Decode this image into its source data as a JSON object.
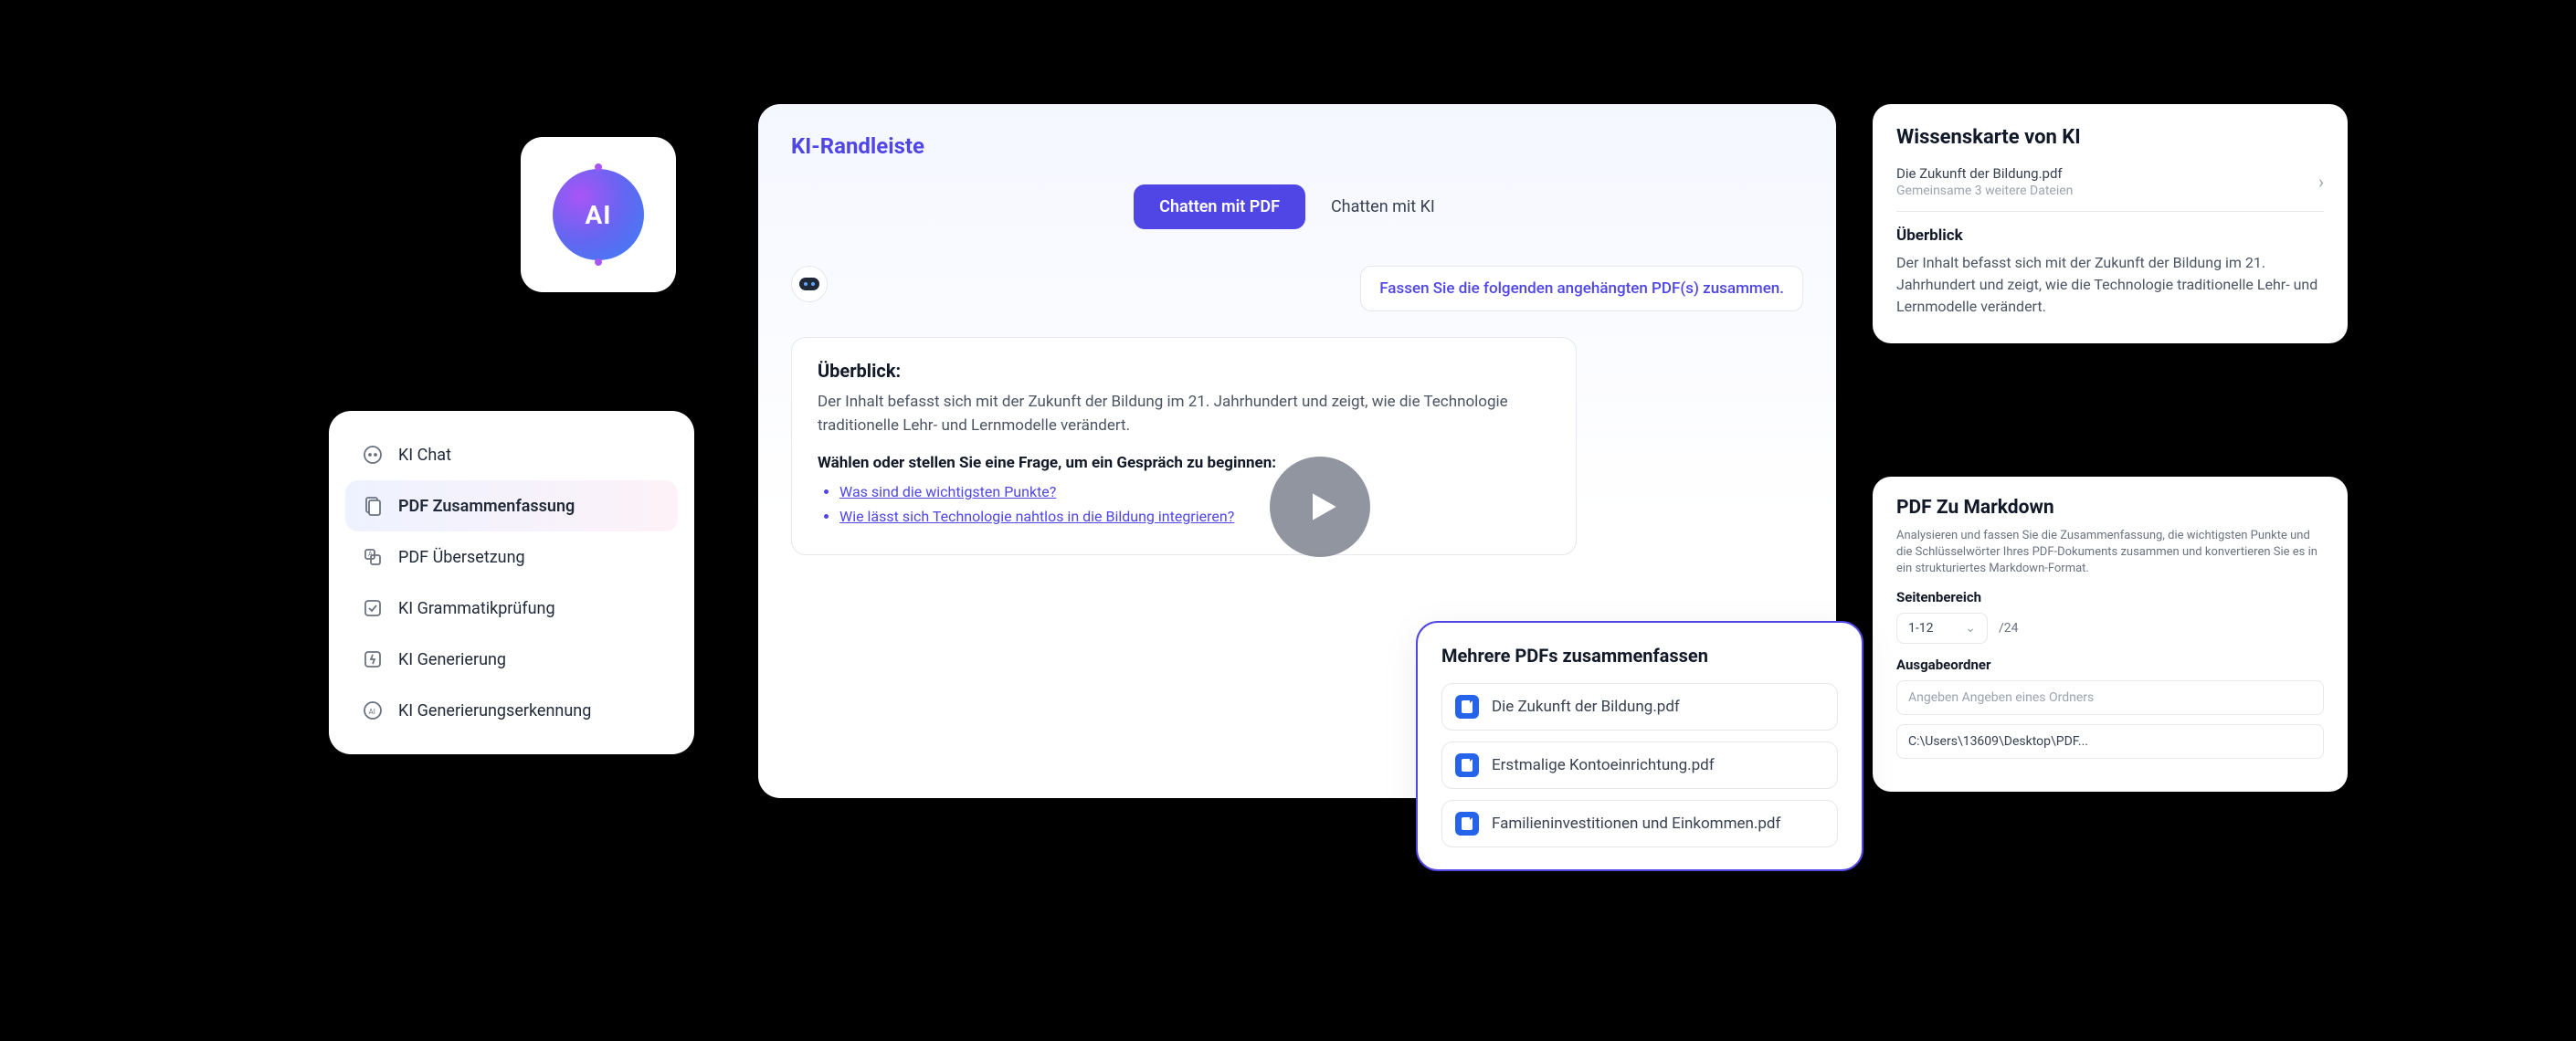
{
  "logo": {
    "text": "AI"
  },
  "sidebar": {
    "items": [
      {
        "label": "KI Chat",
        "icon": "chat-icon"
      },
      {
        "label": "PDF Zusammenfassung",
        "icon": "summary-icon",
        "active": true
      },
      {
        "label": "PDF Übersetzung",
        "icon": "translate-icon"
      },
      {
        "label": "KI Grammatikprüfung",
        "icon": "grammar-icon"
      },
      {
        "label": "KI Generierung",
        "icon": "generate-icon"
      },
      {
        "label": "KI Generierungserkennung",
        "icon": "detect-icon"
      }
    ]
  },
  "main": {
    "title": "KI-Randleiste",
    "tabs": [
      {
        "label": "Chatten mit PDF",
        "active": true
      },
      {
        "label": "Chatten mit KI",
        "active": false
      }
    ],
    "user_prompt": "Fassen Sie die folgenden angehängten PDF(s) zusammen.",
    "overview_heading": "Überblick:",
    "overview_text": "Der Inhalt befasst sich mit der Zukunft der Bildung im 21. Jahrhundert und zeigt, wie die Technologie traditionelle Lehr- und Lernmodelle verändert.",
    "question_prompt": "Wählen oder stellen Sie eine Frage, um ein Gespräch zu beginnen:",
    "suggested_questions": [
      "Was sind die wichtigsten Punkte?",
      "Wie lässt sich Technologie nahtlos in die Bildung integrieren?"
    ]
  },
  "multi_pdf": {
    "title": "Mehrere PDFs zusammenfassen",
    "files": [
      "Die Zukunft der Bildung.pdf",
      "Erstmalige Kontoeinrichtung.pdf",
      "Familieninvestitionen und Einkommen.pdf"
    ]
  },
  "wissenskarte": {
    "title": "Wissenskarte von KI",
    "file_name": "Die Zukunft der Bildung.pdf",
    "file_sub": "Gemeinsame 3 weitere Dateien",
    "section_heading": "Überblick",
    "section_text": "Der Inhalt befasst sich mit der Zukunft der Bildung im 21. Jahrhundert und zeigt, wie die Technologie traditionelle Lehr- und Lernmodelle verändert."
  },
  "markdown": {
    "title": "PDF Zu Markdown",
    "description": "Analysieren und fassen Sie die Zusammenfassung, die wichtigsten Punkte und die Schlüsselwörter Ihres PDF-Dokuments zusammen und konvertieren Sie es in ein strukturiertes Markdown-Format.",
    "range_label": "Seitenbereich",
    "range_value": "1-12",
    "range_total": "/24",
    "output_label": "Ausgabeordner",
    "output_placeholder": "Angeben Angeben eines Ordners",
    "output_value": "C:\\Users\\13609\\Desktop\\PDF..."
  }
}
